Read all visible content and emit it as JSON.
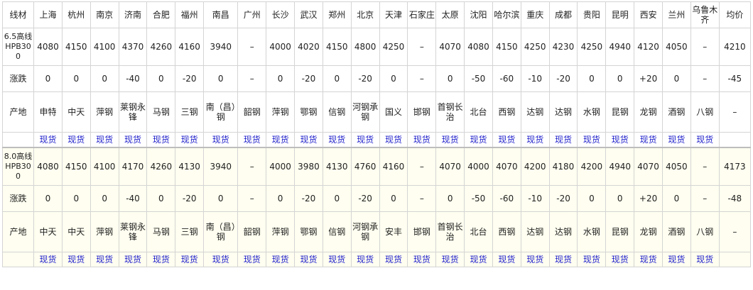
{
  "header": {
    "label": "线材",
    "cities": [
      "上海",
      "杭州",
      "南京",
      "济南",
      "合肥",
      "福州",
      "南昌",
      "广州",
      "长沙",
      "武汉",
      "郑州",
      "北京",
      "天津",
      "石家庄",
      "太原",
      "沈阳",
      "哈尔滨",
      "重庆",
      "成都",
      "贵阳",
      "昆明",
      "西安",
      "兰州",
      "乌鲁木齐"
    ],
    "average": "均价"
  },
  "groups": [
    {
      "spec": "6.5高线HPB300",
      "prices": [
        "4080",
        "4150",
        "4100",
        "4370",
        "4260",
        "4160",
        "3940",
        "–",
        "4000",
        "4020",
        "4150",
        "4800",
        "4250",
        "–",
        "4070",
        "4080",
        "4150",
        "4250",
        "4230",
        "4250",
        "4940",
        "4120",
        "4050",
        "–"
      ],
      "price_avg": "4210",
      "change_label": "涨跌",
      "changes": [
        "0",
        "0",
        "0",
        "-40",
        "0",
        "-20",
        "0",
        "–",
        "0",
        "-20",
        "0",
        "-20",
        "0",
        "–",
        "0",
        "-50",
        "-60",
        "-10",
        "-20",
        "0",
        "0",
        "+20",
        "0",
        "–"
      ],
      "change_avg": "-45",
      "origin_label": "产地",
      "origins": [
        "申特",
        "中天",
        "萍钢",
        "莱钢永锋",
        "马钢",
        "三钢",
        "南（昌）钢",
        "韶钢",
        "萍钢",
        "鄂钢",
        "信钢",
        "河钢承钢",
        "国义",
        "邯钢",
        "首钢长治",
        "北台",
        "西钢",
        "达钢",
        "达钢",
        "水钢",
        "昆钢",
        "龙钢",
        "酒钢",
        "八钢"
      ],
      "origin_avg": "–",
      "spot_label": "现货"
    },
    {
      "spec": "8.0高线HPB300",
      "prices": [
        "4080",
        "4150",
        "4100",
        "4170",
        "4260",
        "4130",
        "3940",
        "–",
        "4000",
        "3980",
        "4130",
        "4760",
        "4160",
        "–",
        "4070",
        "4000",
        "4070",
        "4200",
        "4180",
        "4200",
        "4940",
        "4070",
        "4050",
        "–"
      ],
      "price_avg": "4173",
      "change_label": "涨跌",
      "changes": [
        "0",
        "0",
        "0",
        "-40",
        "0",
        "-20",
        "0",
        "–",
        "0",
        "-20",
        "0",
        "-20",
        "0",
        "–",
        "0",
        "-50",
        "-60",
        "-10",
        "-20",
        "0",
        "0",
        "+20",
        "0",
        "–"
      ],
      "change_avg": "-48",
      "origin_label": "产地",
      "origins": [
        "中天",
        "中天",
        "萍钢",
        "莱钢永锋",
        "马钢",
        "三钢",
        "南（昌）钢",
        "韶钢",
        "萍钢",
        "鄂钢",
        "信钢",
        "河钢承钢",
        "安丰",
        "邯钢",
        "首钢长治",
        "北台",
        "西钢",
        "达钢",
        "达钢",
        "水钢",
        "昆钢",
        "龙钢",
        "酒钢",
        "八钢"
      ],
      "origin_avg": "–",
      "spot_label": "现货"
    }
  ]
}
